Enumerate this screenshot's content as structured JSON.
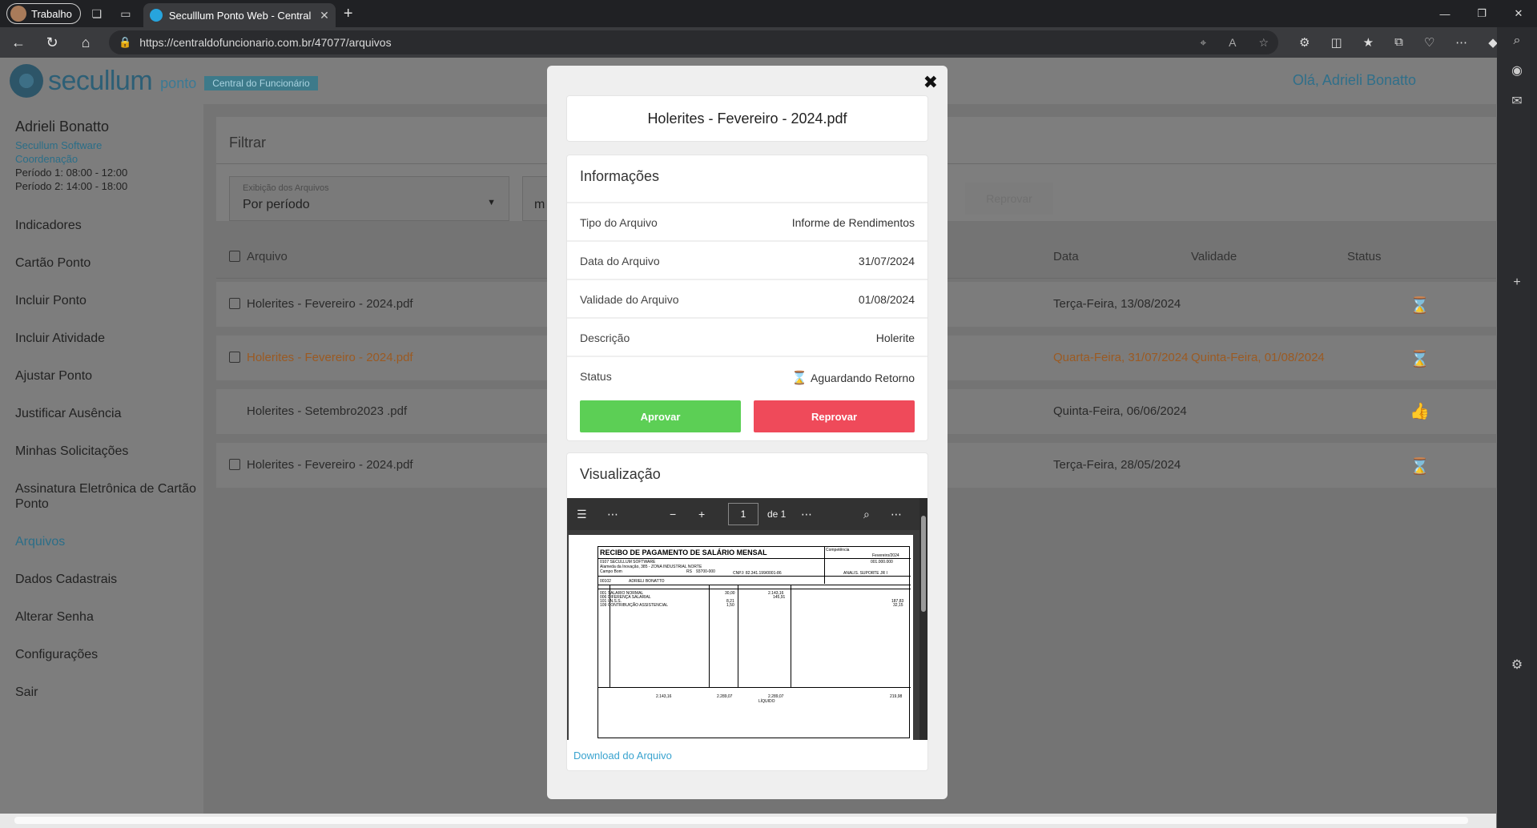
{
  "browser": {
    "profile_label": "Trabalho",
    "tab_title": "Seculllum Ponto Web - Central do",
    "url_host": "https://centraldofuncionario.com.br",
    "url_path": "/47077/arquivos"
  },
  "header": {
    "logo": "secullum",
    "logo_sub": "ponto",
    "badge": "Central do Funcionário",
    "greeting": "Olá, Adrieli Bonatto"
  },
  "user": {
    "name": "Adrieli Bonatto",
    "company": "Secullum Software",
    "role": "Coordenação",
    "period1": "Período 1: 08:00 - 12:00",
    "period2": "Período 2: 14:00 - 18:00"
  },
  "menu": [
    "Indicadores",
    "Cartão Ponto",
    "Incluir Ponto",
    "Incluir Atividade",
    "Ajustar Ponto",
    "Justificar Ausência",
    "Minhas Solicitações",
    "Assinatura Eletrônica de Cartão Ponto",
    "Arquivos",
    "Dados Cadastrais",
    "Alterar Senha",
    "Configurações",
    "Sair"
  ],
  "filter": {
    "title": "Filtrar",
    "display_label": "Exibição dos Arquivos",
    "display_value": "Por período",
    "second_value": "m",
    "ghost_button": "Reprovar"
  },
  "table": {
    "headers": {
      "file": "Arquivo",
      "date": "Data",
      "validity": "Validade",
      "status": "Status"
    },
    "rows": [
      {
        "file": "Holerites - Fevereiro - 2024.pdf",
        "date": "Terça-Feira, 13/08/2024",
        "validity": "",
        "status": "hourglass-icon"
      },
      {
        "file": "Holerites - Fevereiro - 2024.pdf",
        "date": "Quarta-Feira, 31/07/2024",
        "validity": "Quinta-Feira, 01/08/2024",
        "status": "hourglass-icon"
      },
      {
        "file": "Holerites - Setembro2023 .pdf",
        "date": "Quinta-Feira, 06/06/2024",
        "validity": "",
        "status": "thumbs-up-icon"
      },
      {
        "file": "Holerites - Fevereiro - 2024.pdf",
        "date": "Terça-Feira, 28/05/2024",
        "validity": "",
        "status": "hourglass-icon"
      }
    ]
  },
  "modal": {
    "title": "Holerites - Fevereiro - 2024.pdf",
    "info_title": "Informações",
    "info": [
      {
        "key": "Tipo do Arquivo",
        "value": "Informe de Rendimentos"
      },
      {
        "key": "Data do Arquivo",
        "value": "31/07/2024"
      },
      {
        "key": "Validade do Arquivo",
        "value": "01/08/2024"
      },
      {
        "key": "Descrição",
        "value": "Holerite"
      },
      {
        "key": "Status",
        "value": "Aguardando Retorno"
      }
    ],
    "approve": "Aprovar",
    "reject": "Reprovar",
    "preview_title": "Visualização",
    "pdf_page": "1",
    "pdf_of": "de 1",
    "download": "Download do Arquivo"
  },
  "payslip": {
    "title": "RECIBO DE PAGAMENTO DE SALÁRIO MENSAL",
    "competence_label": "Competência",
    "competence": "Fevereiro/2024",
    "company_line": "0107 SECULLUM SOFTWARE",
    "address": "Alameda da Inovação, 385 - ZONA INDUSTRIAL NORTE",
    "city": "Campo Bom",
    "uf": "RS",
    "cep": "93700-000",
    "cnpj": "CNPJ: 82.341.199/0001-86",
    "employee": "ADRIELI BONATTO",
    "employee_code": "00102",
    "function": "ANALIS. SUPORTE JR I",
    "salary_header": "001.000.000",
    "items": [
      "001  SALARIO NORMAL",
      "006  DIFERENÇA SALARIAL",
      "101  I.N.S.S.",
      "109  CONTRIBUIÇÃO ASSISTENCIAL"
    ],
    "refs": [
      "30,00",
      "",
      "8,21",
      "1,50"
    ],
    "earnings": [
      "2.143,16",
      "145,91",
      "",
      ""
    ],
    "deductions": [
      "",
      "",
      "187,83",
      "32,15"
    ],
    "footer_base": "2.143,16",
    "footer_contrib": "2.289,07",
    "footer_total_venc": "2.289,07",
    "footer_total_desc": "219,98",
    "liquid_label": "LÍQUIDO"
  }
}
